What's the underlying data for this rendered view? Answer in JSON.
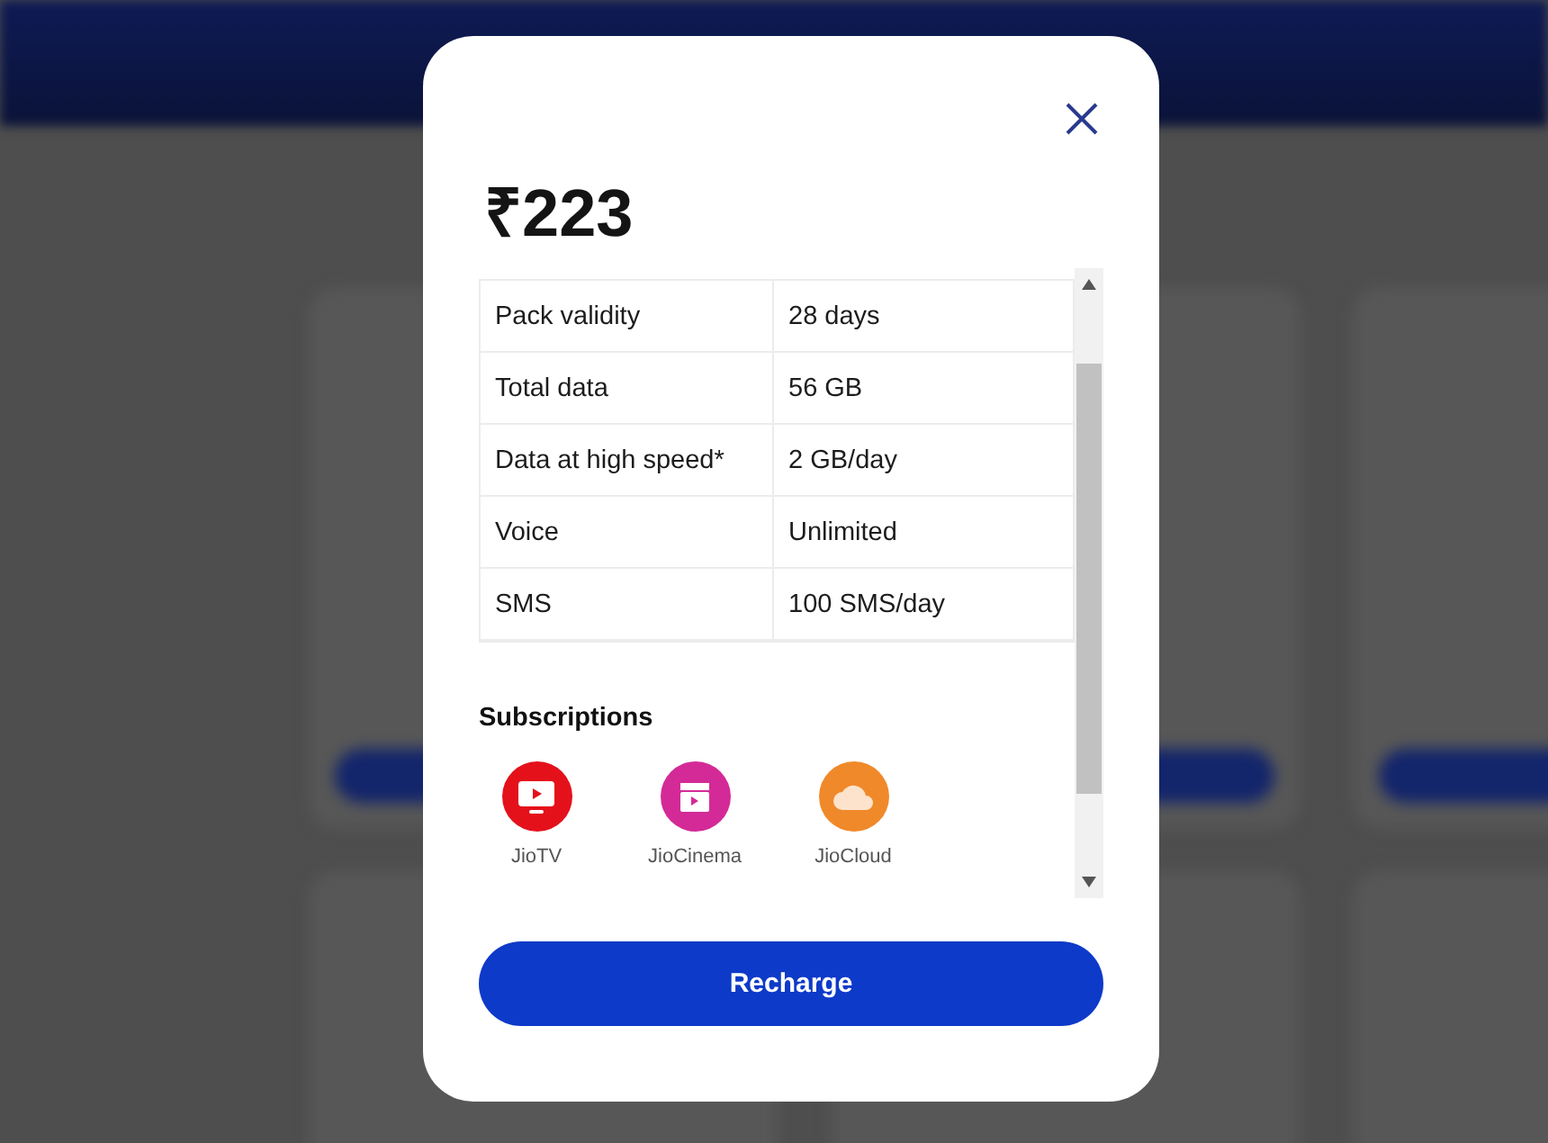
{
  "plan": {
    "price": "₹223"
  },
  "details": [
    {
      "label": "Pack validity",
      "value": "28 days"
    },
    {
      "label": "Total data",
      "value": "56 GB"
    },
    {
      "label": "Data at high speed*",
      "value": "2 GB/day"
    },
    {
      "label": "Voice",
      "value": "Unlimited"
    },
    {
      "label": "SMS",
      "value": "100 SMS/day"
    }
  ],
  "subscriptions": {
    "title": "Subscriptions",
    "items": [
      {
        "kind": "tv",
        "name": "JioTV",
        "color": "#e4111b"
      },
      {
        "kind": "cinema",
        "name": "JioCinema",
        "color": "#d42a97"
      },
      {
        "kind": "cloud",
        "name": "JioCloud",
        "color": "#f0892a"
      }
    ]
  },
  "action": {
    "label": "Recharge"
  }
}
